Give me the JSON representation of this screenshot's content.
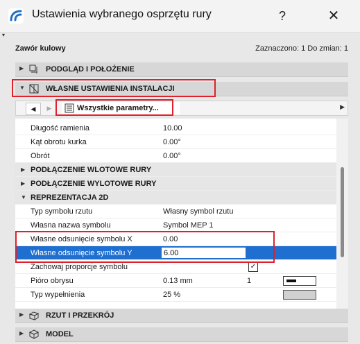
{
  "window": {
    "title": "Ustawienia wybranego osprzętu rury",
    "help_label": "?",
    "close_label": "✕"
  },
  "header": {
    "element_name": "Zawór kulowy",
    "selection_info": "Zaznaczono: 1 Do zmian: 1"
  },
  "sections": {
    "preview": "PODGLĄD I POŁOŻENIE",
    "custom_settings": "WŁASNE USTAWIENIA INSTALACJI",
    "plan_section": "RZUT I PRZEKRÓJ",
    "model": "MODEL"
  },
  "navigator": {
    "selected": "Wszystkie parametry..."
  },
  "params": {
    "rows": [
      {
        "label": "Długość ramienia",
        "value": "10.00"
      },
      {
        "label": "Kąt obrotu kurka",
        "value": "0.00°"
      },
      {
        "label": "Obrót",
        "value": "0.00°"
      }
    ],
    "groups": {
      "inlet": "PODŁĄCZENIE WLOTOWE RURY",
      "outlet": "PODŁĄCZENIE WYLOTOWE RURY",
      "rep2d": "REPREZENTACJA 2D"
    },
    "rep2d_rows": {
      "symbol_type": {
        "label": "Typ symbolu rzutu",
        "value": "Własny symbol rzutu"
      },
      "symbol_name": {
        "label": "Własna nazwa symbolu",
        "value": "Symbol MEP 1"
      },
      "offset_x": {
        "label": "Własne odsunięcie symbolu X",
        "value": "0.00"
      },
      "offset_y": {
        "label": "Własne odsunięcie symbolu Y",
        "value": "6.00"
      },
      "keep_proportion": {
        "label": "Zachowaj proporcje symbolu",
        "checked": true,
        "check_glyph": "✓"
      },
      "outline_pen": {
        "label": "Pióro obrysu",
        "value": "0.13 mm",
        "pen_index": "1"
      },
      "fill_type": {
        "label": "Typ wypełnienia",
        "value": "25 %"
      }
    }
  },
  "colors": {
    "accent": "#1e6fd0",
    "highlight_box": "#e0202a"
  }
}
